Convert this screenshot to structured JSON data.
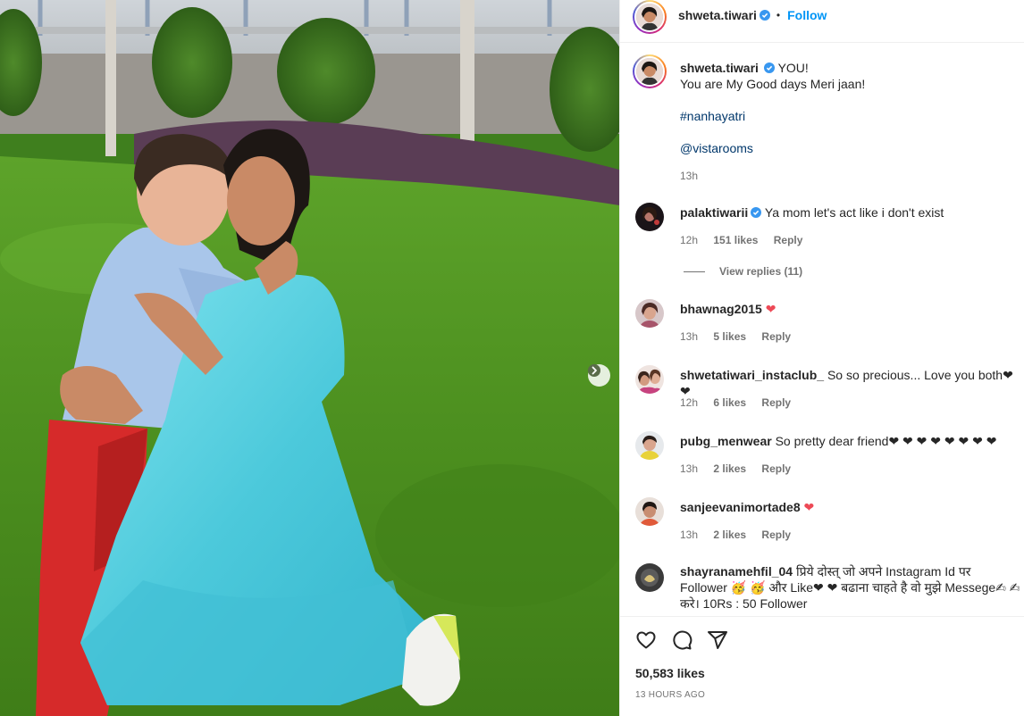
{
  "post": {
    "carousel_next_icon": "chevron-right-icon"
  },
  "header": {
    "username": "shweta.tiwari",
    "verified_icon": "verified-badge-icon",
    "separator": "•",
    "follow_label": "Follow"
  },
  "caption": {
    "username": "shweta.tiwari",
    "line1": "YOU!",
    "line2": "You are My Good days Meri jaan!",
    "hashtag": "#nanhayatri",
    "mention": "@vistarooms",
    "time": "13h"
  },
  "comments": [
    {
      "username": "palaktiwarii",
      "verified": true,
      "text": "Ya mom let's act like i don't exist",
      "time": "12h",
      "likes": "151 likes",
      "reply": "Reply",
      "view_replies": "View replies (11)"
    },
    {
      "username": "bhawnag2015",
      "text": "❤",
      "time": "13h",
      "likes": "5 likes",
      "reply": "Reply"
    },
    {
      "username": "shwetatiwari_instaclub_",
      "text": "So so precious... Love you both❤ ❤",
      "time": "12h",
      "likes": "6 likes",
      "reply": "Reply"
    },
    {
      "username": "pubg_menwear",
      "text": "So pretty dear friend❤ ❤ ❤ ❤ ❤ ❤ ❤ ❤",
      "time": "13h",
      "likes": "2 likes",
      "reply": "Reply"
    },
    {
      "username": "sanjeevanimortade8",
      "text": "❤",
      "time": "13h",
      "likes": "2 likes",
      "reply": "Reply"
    },
    {
      "username": "shayranamehfil_04",
      "text": "प्रिये दोस्त् जो अपने Instagram Id पर Follower 🥳 🥳 और Like❤ ❤ बढाना चाहते है वो मुझे Messege✍ ✍ करे। 10Rs : 50 Follower"
    }
  ],
  "actions": {
    "like_icon": "heart-icon",
    "comment_icon": "comment-icon",
    "share_icon": "share-icon",
    "likes": "50,583 likes",
    "time_ago": "13 HOURS AGO"
  },
  "colors": {
    "accent": "#0095f6",
    "verified": "#3897f0",
    "heart": "#ed4956",
    "muted": "#737373"
  }
}
